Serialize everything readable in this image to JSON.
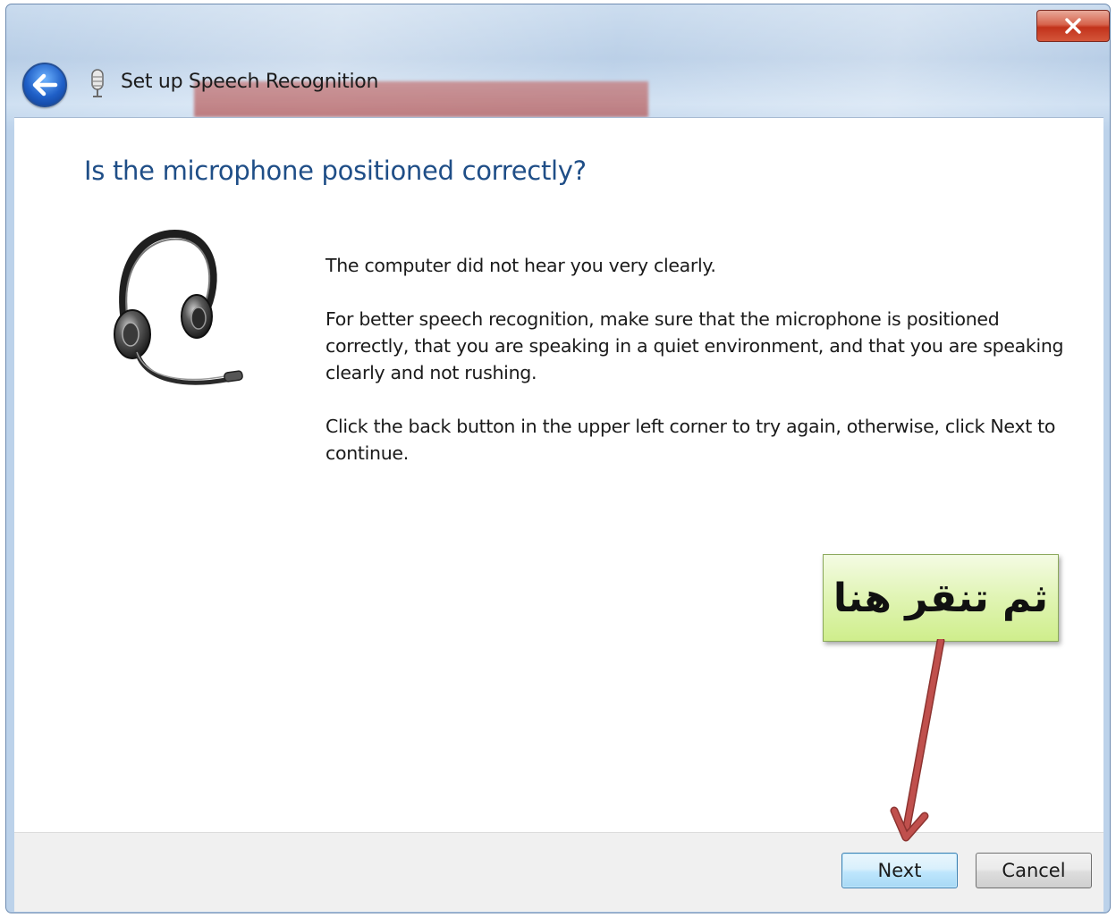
{
  "window": {
    "title": "Set up Speech Recognition",
    "close_icon": "close-icon",
    "back_icon": "back-arrow-icon",
    "app_icon": "microphone-icon"
  },
  "page": {
    "heading": "Is the microphone positioned correctly?",
    "illustration": "headset-icon",
    "paragraphs": [
      "The computer did not hear you very clearly.",
      "For better speech recognition, make sure that the microphone is positioned correctly, that you are speaking in a quiet environment, and that you are speaking clearly and not rushing.",
      "Click the back button in the upper left corner to try again, otherwise, click Next to continue."
    ]
  },
  "footer": {
    "next_label": "Next",
    "cancel_label": "Cancel"
  },
  "annotation": {
    "callout_text": "ثم تنقر هنا",
    "arrow_color": "#c0504d",
    "callout_color": "#d7f0a0"
  },
  "colors": {
    "heading": "#1f4e87",
    "close_button": "#c2321b",
    "back_button": "#1f5fc7"
  }
}
